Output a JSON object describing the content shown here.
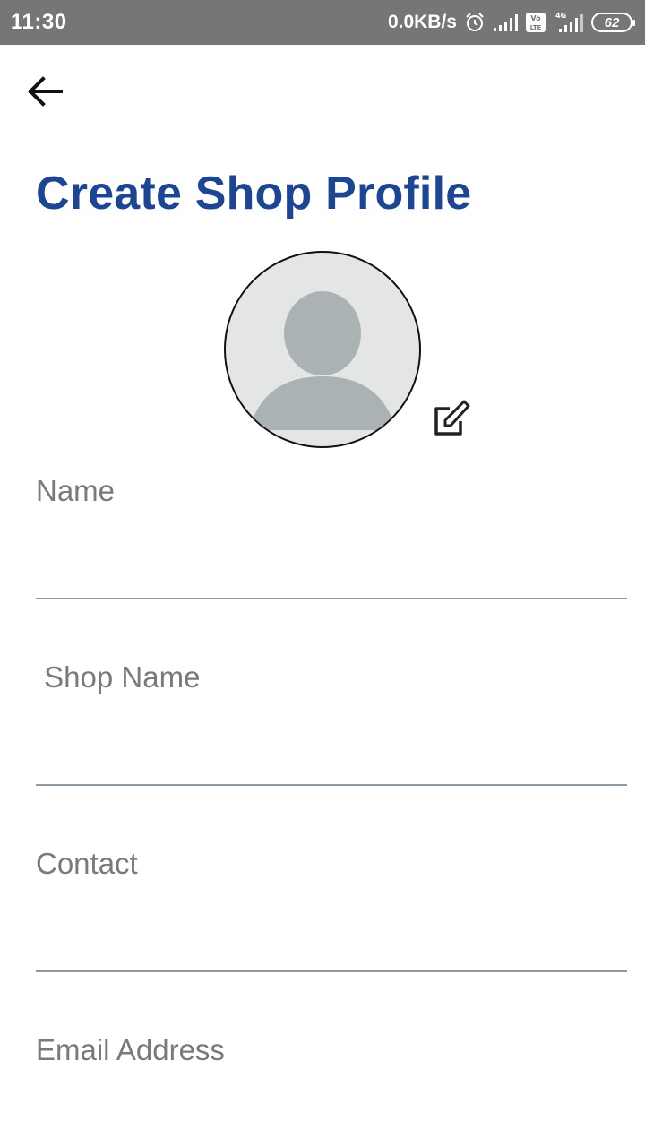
{
  "status_bar": {
    "time": "11:30",
    "network_speed": "0.0KB/s",
    "battery_level": "62",
    "icons": [
      "alarm-icon",
      "signal-icon",
      "volte-icon",
      "signal-4g-icon",
      "battery-icon"
    ],
    "volte_text": "Vo LTE",
    "lte_label": "4G"
  },
  "header": {
    "back_icon": "arrow-left-icon",
    "title": "Create Shop Profile"
  },
  "avatar": {
    "icon": "person-placeholder-icon",
    "edit_icon": "edit-square-icon"
  },
  "form": {
    "fields": [
      {
        "label": "Name",
        "value": ""
      },
      {
        "label": " Shop Name",
        "value": ""
      },
      {
        "label": "Contact",
        "value": ""
      },
      {
        "label": "Email Address",
        "value": ""
      }
    ]
  },
  "colors": {
    "title": "#1c4593",
    "label": "#7a7a7a",
    "underline": "#8c9aa6",
    "status_bar": "#767676",
    "avatar_bg": "#e4e6e5",
    "avatar_figure": "#aab2b3"
  }
}
